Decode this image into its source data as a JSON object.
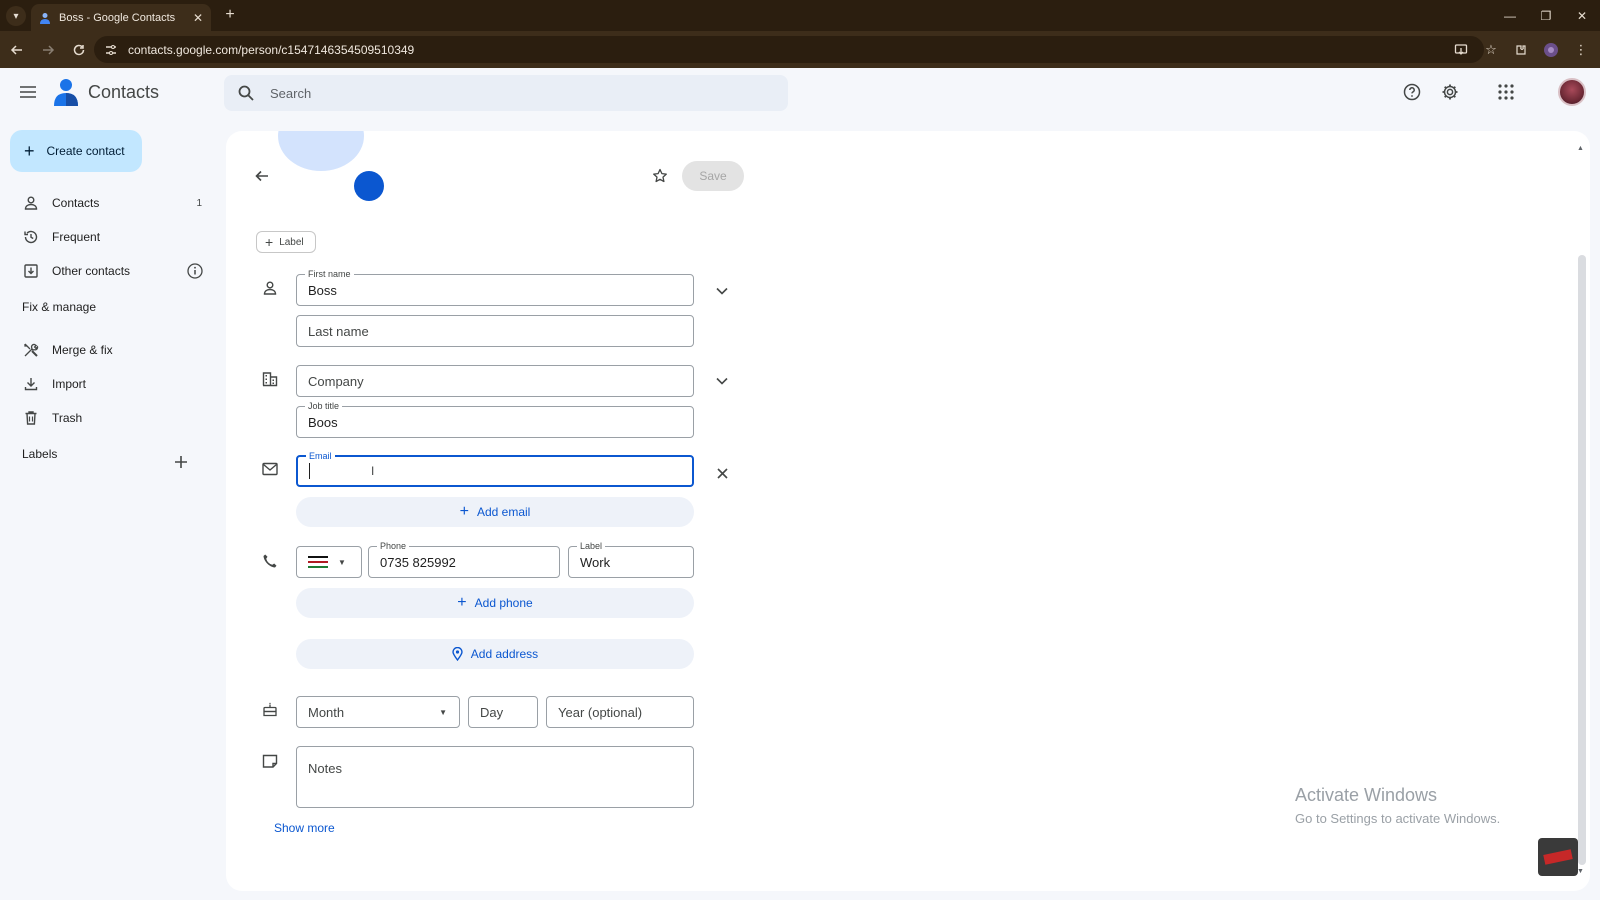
{
  "browser": {
    "tab_title": "Boss - Google Contacts",
    "url": "contacts.google.com/person/c1547146354509510349",
    "new_tab": "+",
    "tab_close": "✕",
    "window_minimize": "—",
    "window_restore": "❐",
    "window_close": "✕"
  },
  "header": {
    "app_title": "Contacts",
    "search_placeholder": "Search"
  },
  "sidebar": {
    "create_label": "Create contact",
    "items": [
      {
        "label": "Contacts",
        "count": "1"
      },
      {
        "label": "Frequent"
      },
      {
        "label": "Other contacts"
      }
    ],
    "fix_manage_heading": "Fix & manage",
    "fix_items": [
      {
        "label": "Merge & fix"
      },
      {
        "label": "Import"
      },
      {
        "label": "Trash"
      }
    ],
    "labels_heading": "Labels"
  },
  "editor": {
    "save_label": "Save",
    "label_chip": "Label",
    "first_name": {
      "label": "First name",
      "value": "Boss"
    },
    "last_name": {
      "placeholder": "Last name"
    },
    "company": {
      "placeholder": "Company"
    },
    "job_title": {
      "label": "Job title",
      "value": "Boos"
    },
    "email": {
      "label": "Email",
      "value": ""
    },
    "add_email": "Add email",
    "phone": {
      "label": "Phone",
      "value": "0735 825992",
      "country_flag": "kenya-flag-icon"
    },
    "phone_label": {
      "label": "Label",
      "value": "Work"
    },
    "add_phone": "Add phone",
    "add_address": "Add address",
    "birthday": {
      "month_placeholder": "Month",
      "day_placeholder": "Day",
      "year_placeholder": "Year (optional)"
    },
    "notes_placeholder": "Notes",
    "show_more": "Show more"
  },
  "overlay": {
    "activate_title": "Activate Windows",
    "activate_sub": "Go to Settings to activate Windows."
  },
  "colors": {
    "accent": "#0b57d0",
    "create_button": "#c2e7ff",
    "browser_frame": "#3d2d1a"
  }
}
